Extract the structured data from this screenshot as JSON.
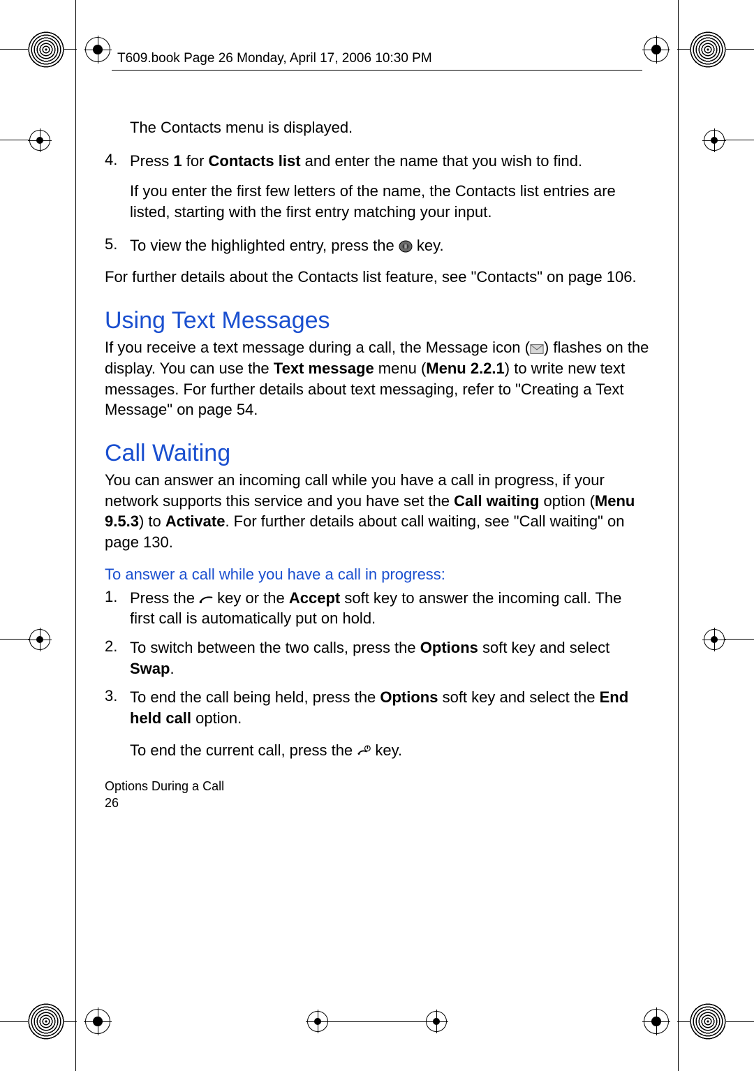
{
  "header": {
    "running": "T609.book  Page 26  Monday, April 17, 2006  10:30 PM"
  },
  "intro": {
    "contacts_menu": "The Contacts menu is displayed."
  },
  "step4": {
    "num": "4.",
    "lead": "Press ",
    "b1": "1",
    "mid": " for ",
    "b2": "Contacts list",
    "tail": " and enter the name that you wish to find.",
    "para": "If you enter the first few letters of the name, the Contacts list entries are listed, starting with the first entry matching your input."
  },
  "step5": {
    "num": "5.",
    "lead": "To view the highlighted entry, press the ",
    "tail": " key."
  },
  "further_contacts": "For further details about the Contacts list feature, see \"Contacts\" on page 106.",
  "sec_text": {
    "title": "Using Text Messages",
    "p1a": "If you receive a text message during a call, the Message icon (",
    "p1b": ") flashes on the display. You can use the ",
    "b1": "Text message",
    "p1c": " menu (",
    "b2": "Menu 2.2.1",
    "p1d": ") to write new text messages. For further details about text messaging, refer to \"Creating a Text Message\" on page 54."
  },
  "sec_cw": {
    "title": "Call Waiting",
    "p_a": "You can answer an incoming call while you have a call in progress, if your network supports this service and you have set the ",
    "b1": "Call waiting",
    "p_b": " option (",
    "b2": "Menu 9.5.3",
    "p_c": ") to ",
    "b3": "Activate",
    "p_d": ". For further details about call waiting, see \"Call waiting\" on page 130.",
    "sub": "To answer a call while you have a call in progress:"
  },
  "cw1": {
    "num": "1.",
    "a": "Press the ",
    "b": " key or the ",
    "bold1": "Accept",
    "c": " soft key to answer the incoming call. The first call is automatically put on hold."
  },
  "cw2": {
    "num": "2.",
    "a": "To switch between the two calls, press the ",
    "bold1": "Options",
    "b": " soft key and select ",
    "bold2": "Swap",
    "c": "."
  },
  "cw3": {
    "num": "3.",
    "a": "To end the call being held, press the ",
    "bold1": "Options",
    "b": " soft key and select the ",
    "bold2": "End held call",
    "c": " option.",
    "sub_a": "To end the current call, press the ",
    "sub_b": " key."
  },
  "footer": {
    "section": "Options During a Call",
    "page": "26"
  }
}
